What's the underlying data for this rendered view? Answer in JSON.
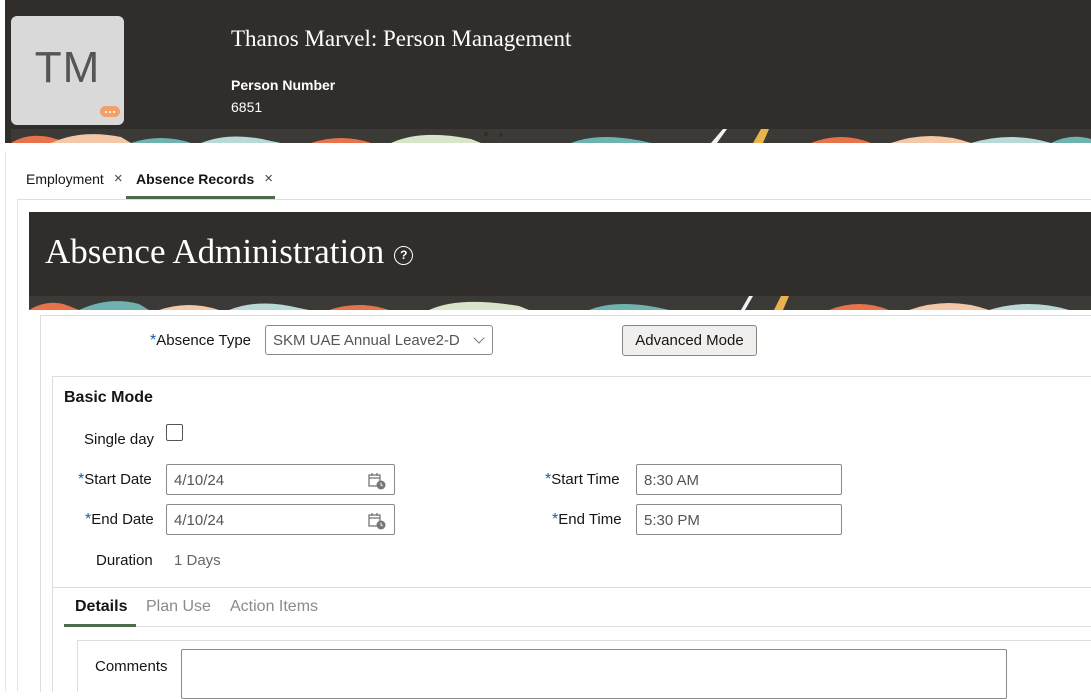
{
  "header": {
    "avatar_initials": "TM",
    "person_name": "Thanos Marvel: Person Management",
    "person_number_label": "Person Number",
    "person_number_value": "6851"
  },
  "tabs": [
    {
      "label": "Employment",
      "close": "×"
    },
    {
      "label": "Absence Records",
      "close": "×",
      "active": true
    }
  ],
  "page": {
    "title": "Absence Administration",
    "help": "?"
  },
  "form": {
    "required_marker": "*",
    "absence_type_label": "Absence Type",
    "absence_type_value": "SKM UAE Annual Leave2-D",
    "advanced_mode_button": "Advanced Mode",
    "section_title": "Basic Mode",
    "single_day_label": "Single day",
    "single_day_checked": false,
    "start_date_label": "Start Date",
    "start_date_value": "4/10/24",
    "end_date_label": "End Date",
    "end_date_value": "4/10/24",
    "start_time_label": "Start Time",
    "start_time_value": "8:30 AM",
    "end_time_label": "End Time",
    "end_time_value": "5:30 PM",
    "duration_label": "Duration",
    "duration_value": "1 Days"
  },
  "subtabs": [
    {
      "label": "Details",
      "active": true
    },
    {
      "label": "Plan Use"
    },
    {
      "label": "Action Items"
    }
  ],
  "details": {
    "comments_label": "Comments",
    "comments_value": ""
  },
  "colors": {
    "header_bg": "#312d2a",
    "accent_green": "#4b6b4a",
    "required_blue": "#1a5c9e"
  },
  "icons": [
    "calendar-icon",
    "close-icon",
    "help-icon",
    "chevron-down-icon",
    "chat-bubble-icon"
  ]
}
